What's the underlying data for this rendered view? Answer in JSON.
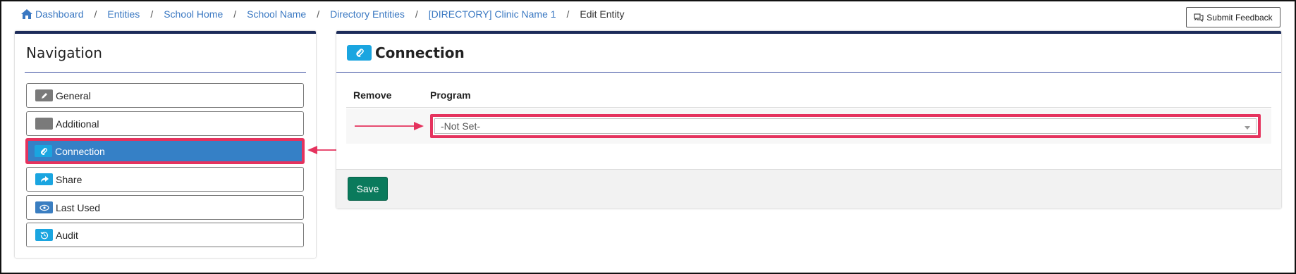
{
  "breadcrumb": {
    "items": [
      "Dashboard",
      "Entities",
      "School Home",
      "School Name",
      "Directory Entities",
      "[DIRECTORY] Clinic Name 1"
    ],
    "current": "Edit Entity",
    "separator": "/"
  },
  "feedback": {
    "label": "Submit Feedback"
  },
  "navigation": {
    "title": "Navigation",
    "items": [
      {
        "label": "General",
        "icon": "pencil-icon",
        "active": false
      },
      {
        "label": "Additional",
        "icon": "blank-icon",
        "active": false
      },
      {
        "label": "Connection",
        "icon": "paperclip-icon",
        "active": true
      },
      {
        "label": "Share",
        "icon": "share-icon",
        "active": false
      },
      {
        "label": "Last Used",
        "icon": "eye-icon",
        "active": false
      },
      {
        "label": "Audit",
        "icon": "history-icon",
        "active": false
      }
    ]
  },
  "connection": {
    "title": "Connection",
    "columns": {
      "remove": "Remove",
      "program": "Program"
    },
    "program_select": {
      "value": "-Not Set-"
    },
    "save_label": "Save"
  },
  "colors": {
    "link": "#3a78c2",
    "panel_top": "#1d2c5a",
    "active_item": "#3580c6",
    "highlight": "#e5335e",
    "save": "#0a7a5c"
  }
}
